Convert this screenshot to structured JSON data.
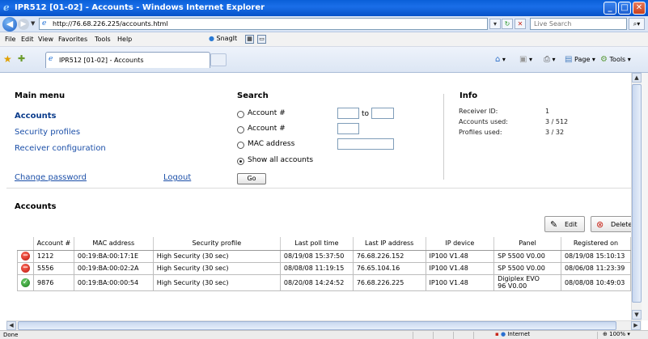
{
  "window": {
    "title": "IPR512 [01-02] - Accounts - Windows Internet Explorer"
  },
  "browser": {
    "url": "http://76.68.226.225/accounts.html",
    "search_placeholder": "Live Search",
    "menu": [
      "File",
      "Edit",
      "View",
      "Favorites",
      "Tools",
      "Help"
    ],
    "snagit": "SnagIt",
    "tab_label": "IPR512 [01-02] - Accounts",
    "cmd_page": "Page",
    "cmd_tools": "Tools"
  },
  "main_menu": {
    "title": "Main menu",
    "accounts": "Accounts",
    "security_profiles": "Security profiles",
    "receiver_configuration": "Receiver configuration",
    "change_password": "Change password",
    "logout": "Logout"
  },
  "search": {
    "title": "Search",
    "opt_account_range": "Account #",
    "to": "to",
    "opt_account": "Account #",
    "opt_mac": "MAC address",
    "opt_show_all": "Show all accounts",
    "go": "Go"
  },
  "info": {
    "title": "Info",
    "receiver_id_label": "Receiver ID:",
    "receiver_id": "1",
    "accounts_used_label": "Accounts used:",
    "accounts_used": "3 / 512",
    "profiles_used_label": "Profiles used:",
    "profiles_used": "3 / 32"
  },
  "accounts": {
    "title": "Accounts",
    "edit": "Edit",
    "delete": "Delete",
    "columns": [
      "Account #",
      "MAC address",
      "Security profile",
      "Last poll time",
      "Last IP address",
      "IP device",
      "Panel",
      "Registered on"
    ],
    "rows": [
      {
        "status": "offline",
        "account": "1212",
        "mac": "00:19:BA:00:17:1E",
        "profile": "High Security (30 sec)",
        "poll": "08/19/08 15:37:50",
        "ip": "76.68.226.152",
        "device": "IP100  V1.48",
        "panel": "SP 5500  V0.00",
        "registered": "08/19/08 15:10:13"
      },
      {
        "status": "offline",
        "account": "5556",
        "mac": "00:19:BA:00:02:2A",
        "profile": "High Security (30 sec)",
        "poll": "08/08/08 11:19:15",
        "ip": "76.65.104.16",
        "device": "IP100  V1.48",
        "panel": "SP 5500  V0.00",
        "registered": "08/06/08 11:23:39"
      },
      {
        "status": "online",
        "account": "9876",
        "mac": "00:19:BA:00:00:54",
        "profile": "High Security (30 sec)",
        "poll": "08/20/08 14:24:52",
        "ip": "76.68.226.225",
        "device": "IP100  V1.48",
        "panel": "Digiplex EVO",
        "panel_version": "96  V0.00",
        "registered": "08/08/08 10:49:03"
      }
    ]
  },
  "status": {
    "text": "Done",
    "zone": "Internet",
    "zoom": "100%"
  },
  "colors": {
    "titlebar": "#0a5fd8",
    "link": "#1b4fa8",
    "status_offline": "#b8130b",
    "status_online": "#1c7a1c"
  }
}
